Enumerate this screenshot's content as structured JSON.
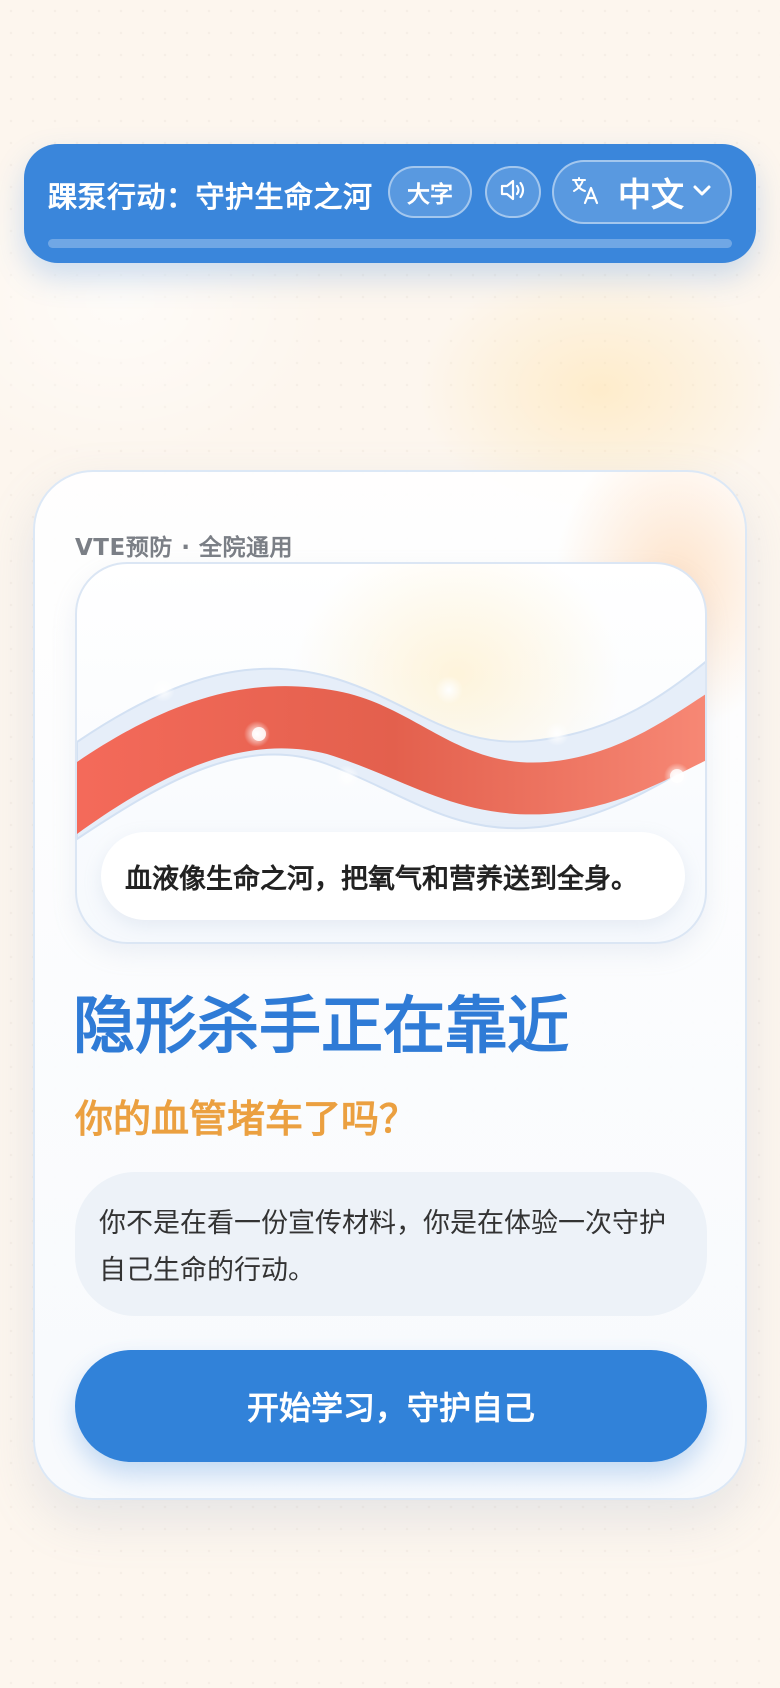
{
  "header": {
    "title": "踝泵行动：守护生命之河",
    "large_text_label": "大字",
    "audio_icon": "speaker-icon",
    "language": {
      "icon": "translate-icon",
      "label": "中文",
      "chevron_icon": "chevron-down-icon"
    }
  },
  "card": {
    "eyebrow": "VTE预防 · 全院通用",
    "hero_caption": "血液像生命之河，把氧气和营养送到全身。",
    "headline": "隐形杀手正在靠近",
    "subheadline": "你的血管堵车了吗？",
    "note": "你不是在看一份宣传材料，你是在体验一次守护自己生命的行动。",
    "cta_label": "开始学习，守护自己"
  },
  "colors": {
    "primary": "#3a86db",
    "headline": "#2f7bd6",
    "accent": "#eba040",
    "river": "#e8604c"
  }
}
